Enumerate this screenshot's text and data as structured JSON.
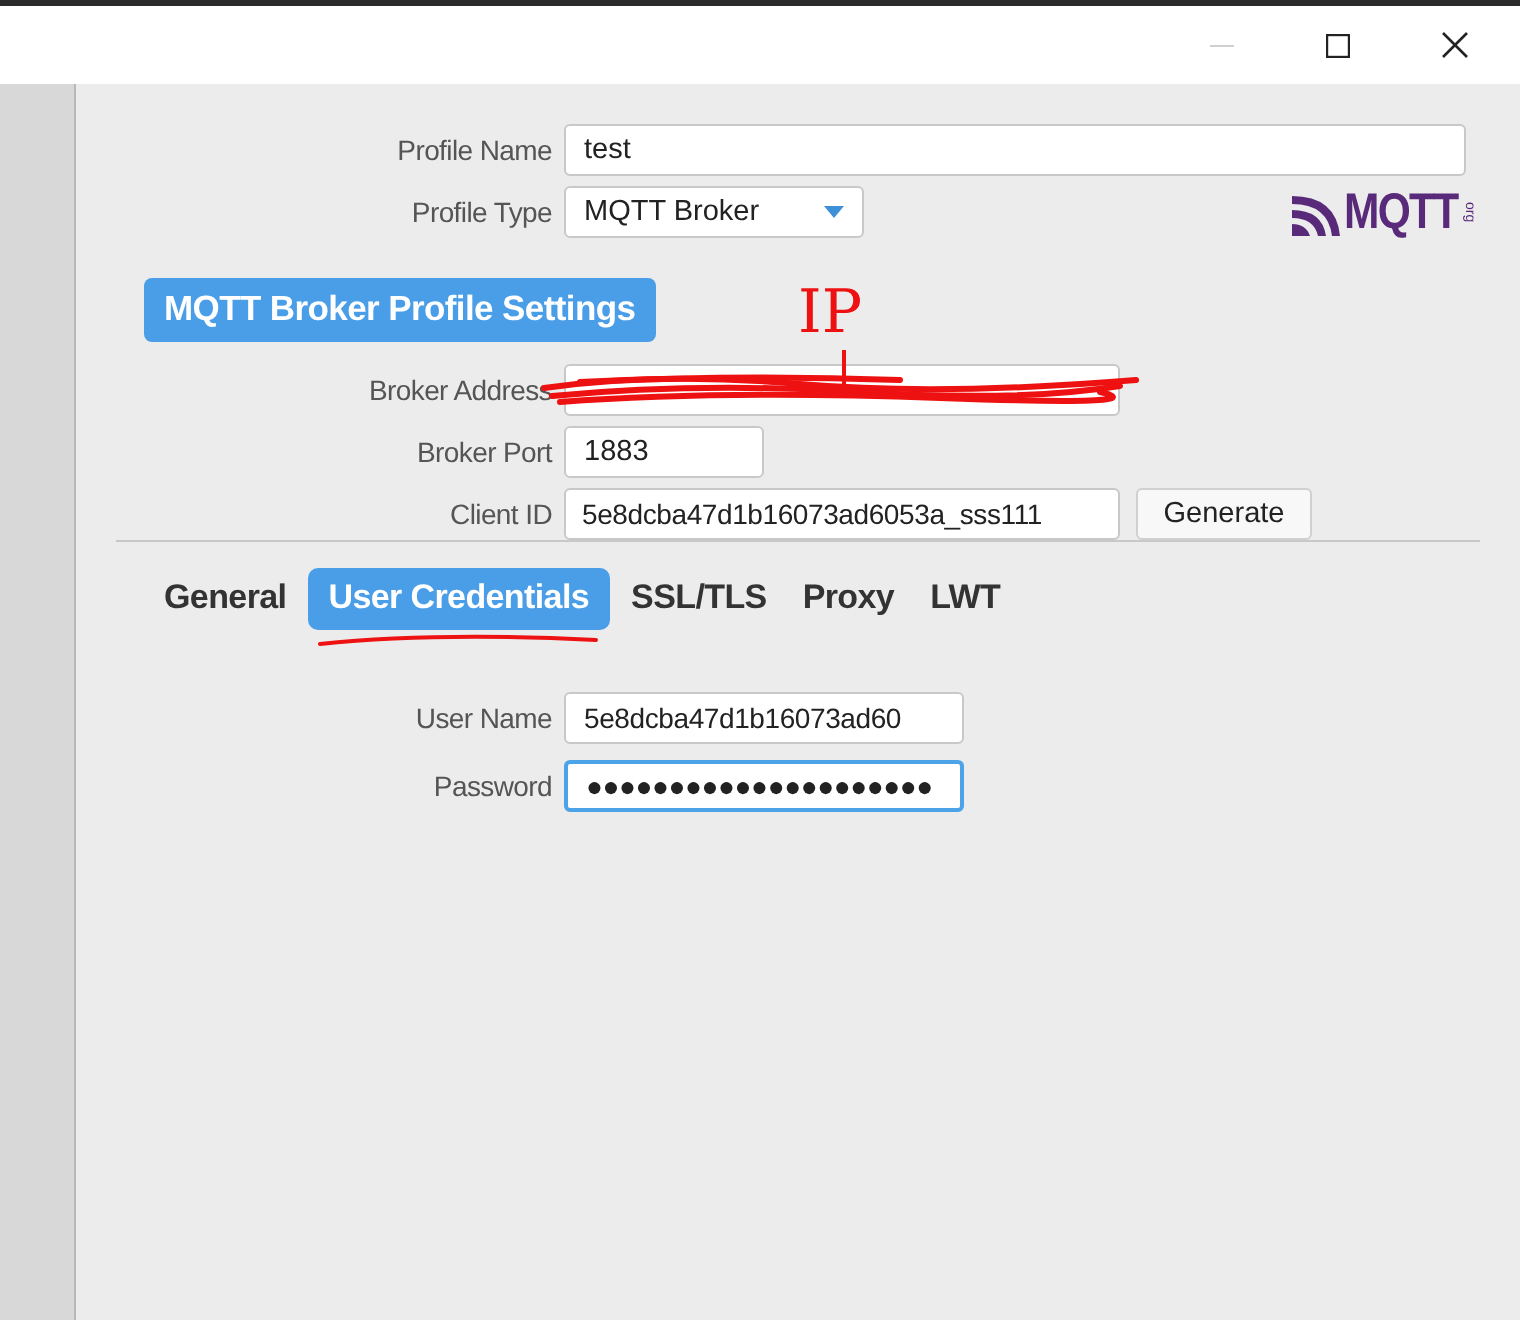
{
  "window": {
    "controls": [
      {
        "kind": "minimize",
        "disabled": true
      },
      {
        "kind": "maximize",
        "disabled": false
      },
      {
        "kind": "close",
        "disabled": false
      }
    ]
  },
  "profile": [
    {
      "label": "Profile Name",
      "value": "test",
      "kind": "text"
    },
    {
      "label": "Profile Type",
      "value": "MQTT Broker",
      "kind": "dropdown"
    }
  ],
  "logo": {
    "text": "MQTT",
    "suffix": "org"
  },
  "section_title": "MQTT Broker Profile Settings",
  "broker_fields": [
    {
      "label": "Broker Address",
      "kind": "redacted"
    },
    {
      "label": "Broker Port",
      "value": "1883",
      "kind": "short"
    },
    {
      "label": "Client ID",
      "value": "5e8dcba47d1b16073ad6053a_sss111",
      "kind": "text",
      "button": "Generate"
    }
  ],
  "tabs": [
    {
      "label": "General",
      "selected": false
    },
    {
      "label": "User Credentials",
      "selected": true
    },
    {
      "label": "SSL/TLS",
      "selected": false
    },
    {
      "label": "Proxy",
      "selected": false
    },
    {
      "label": "LWT",
      "selected": false
    }
  ],
  "credentials": [
    {
      "label": "User Name",
      "value": "5e8dcba47d1b16073ad60",
      "focused": false
    },
    {
      "label": "Password",
      "value": "●●●●●●●●●●●●●●●●●●●●●",
      "focused": true
    }
  ],
  "annotations": [
    {
      "kind": "scribble"
    },
    {
      "kind": "handwriting",
      "text": "IP"
    },
    {
      "kind": "underline"
    }
  ]
}
